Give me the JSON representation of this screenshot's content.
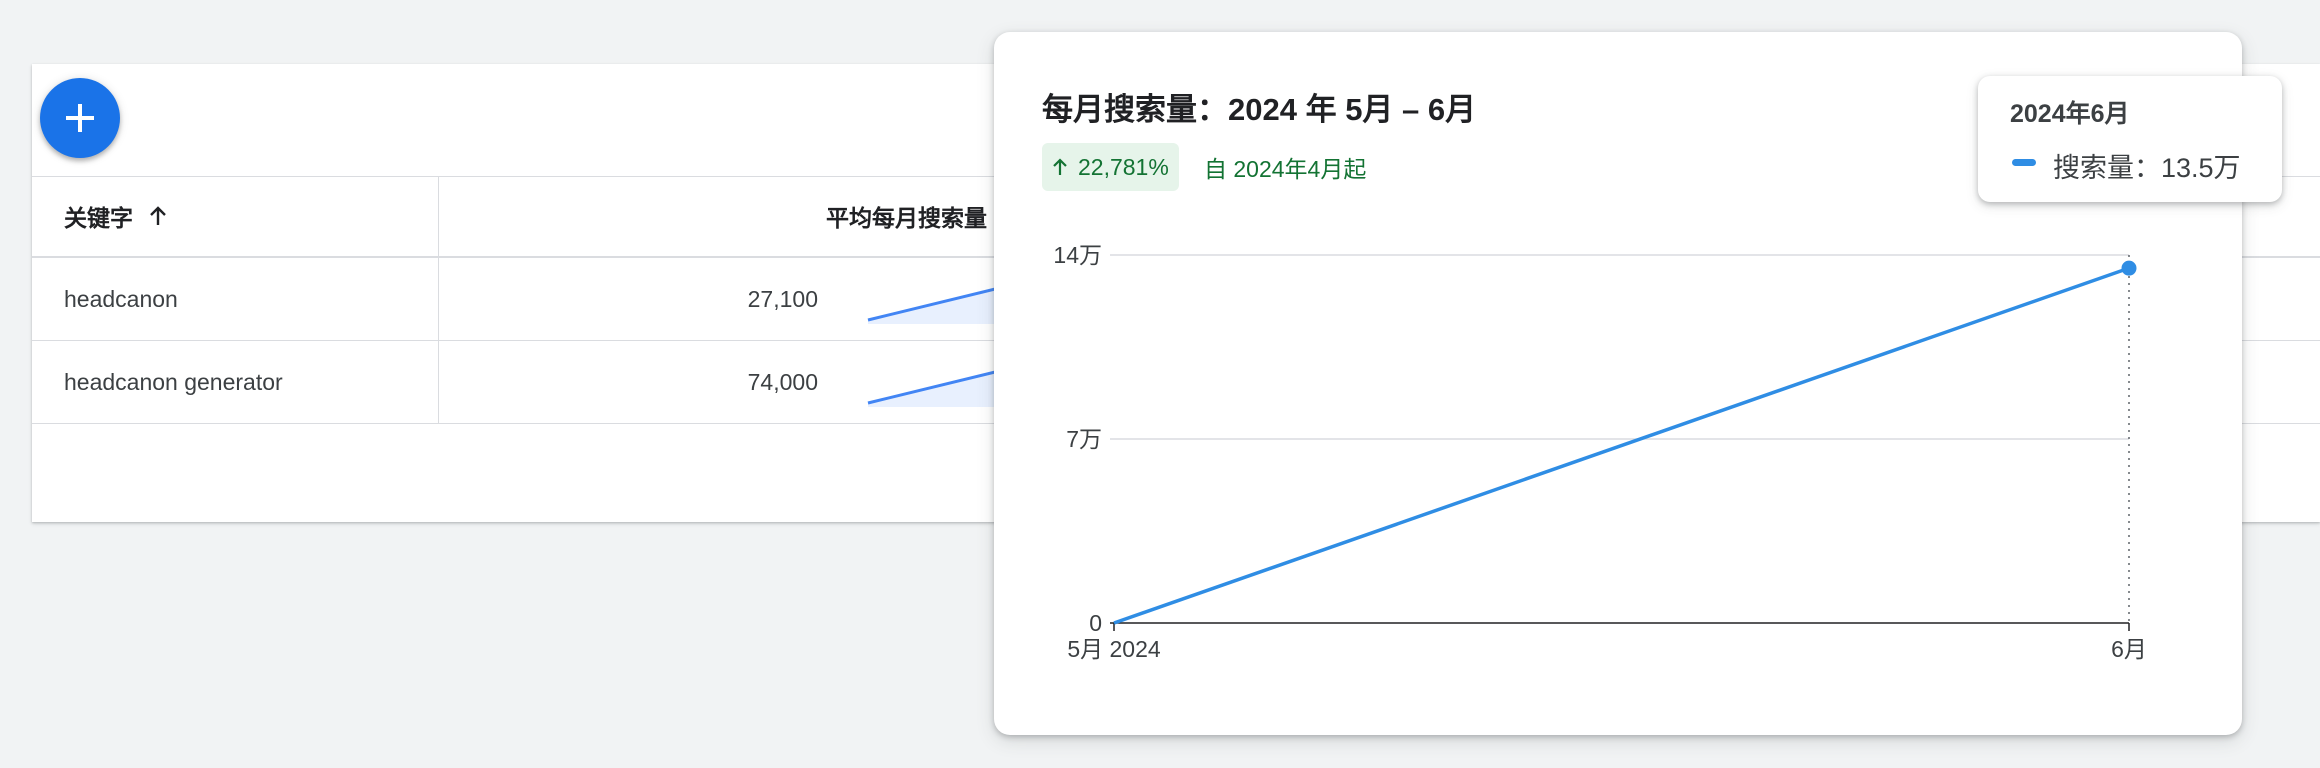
{
  "table": {
    "add_button_icon": "plus-icon",
    "header": {
      "keyword": "关键字",
      "sort_icon": "arrow-up-icon",
      "avg_monthly": "平均每月搜索量"
    },
    "rows": [
      {
        "keyword": "headcanon",
        "volume": "27,100"
      },
      {
        "keyword": "headcanon generator",
        "volume": "74,000"
      }
    ]
  },
  "popover": {
    "title": "每月搜索量：2024 年 5月 – 6月",
    "change": {
      "icon": "arrow-up-icon",
      "value": "22,781%"
    },
    "since": "自 2024年4月起"
  },
  "chart_data": {
    "type": "line",
    "x": [
      "5月 2024",
      "6月"
    ],
    "series": [
      {
        "name": "搜索量",
        "values": [
          0,
          135000
        ]
      }
    ],
    "ylim": [
      0,
      140000
    ],
    "yticks": [
      {
        "value": 0,
        "label": "0"
      },
      {
        "value": 70000,
        "label": "7万"
      },
      {
        "value": 140000,
        "label": "14万"
      }
    ],
    "grid": true,
    "color": "#2f8de4"
  },
  "tooltip": {
    "date": "2024年6月",
    "series_label": "搜索量：13.5万"
  }
}
